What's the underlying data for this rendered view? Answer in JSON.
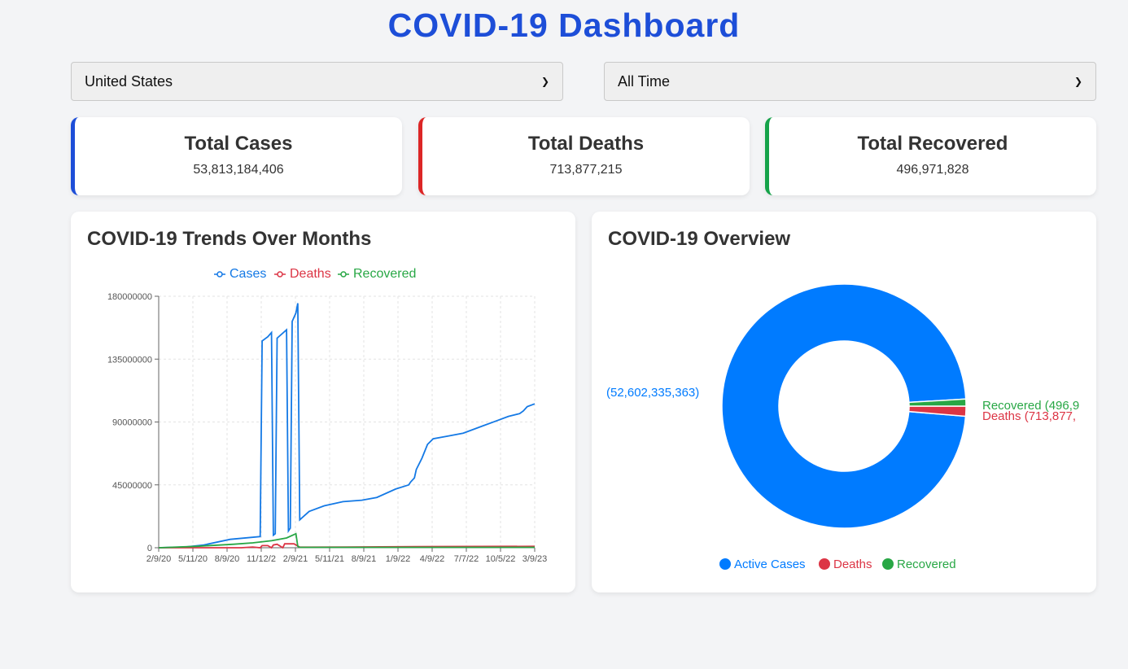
{
  "header": {
    "title": "COVID-19 Dashboard"
  },
  "filters": {
    "country": {
      "value": "United States"
    },
    "period": {
      "value": "All Time"
    }
  },
  "stats": [
    {
      "label": "Total Cases",
      "value": "53,813,184,406",
      "color": "#1d4ed8"
    },
    {
      "label": "Total Deaths",
      "value": "713,877,215",
      "color": "#dc2626"
    },
    {
      "label": "Total Recovered",
      "value": "496,971,828",
      "color": "#16a34a"
    }
  ],
  "colors": {
    "cases": "#1479e5",
    "deaths": "#dc3545",
    "recovered": "#28a745",
    "active": "#007bff"
  },
  "line_panel": {
    "title": "COVID-19 Trends Over Months"
  },
  "pie_panel": {
    "title": "COVID-19 Overview"
  },
  "chart_data": [
    {
      "type": "line",
      "title": "COVID-19 Trends Over Months",
      "x_ticks": [
        "2/9/20",
        "5/11/20",
        "8/9/20",
        "11/12/2",
        "2/9/21",
        "5/11/21",
        "8/9/21",
        "1/9/22",
        "4/9/22",
        "7/7/22",
        "10/5/22",
        "3/9/23"
      ],
      "y_ticks": [
        "180000000",
        "135000000",
        "90000000",
        "45000000",
        "0"
      ],
      "ylim": [
        0,
        180000000
      ],
      "grid": true,
      "legend": "top",
      "series": [
        {
          "name": "Cases",
          "color": "#1479e5",
          "points": [
            [
              0.0,
              0
            ],
            [
              0.07,
              500000
            ],
            [
              0.12,
              2000000
            ],
            [
              0.19,
              6000000
            ],
            [
              0.27,
              8000000
            ],
            [
              0.275,
              148000000
            ],
            [
              0.29,
              151000000
            ],
            [
              0.3,
              154000000
            ],
            [
              0.305,
              9000000
            ],
            [
              0.31,
              10000000
            ],
            [
              0.315,
              150000000
            ],
            [
              0.34,
              156000000
            ],
            [
              0.345,
              12000000
            ],
            [
              0.35,
              14000000
            ],
            [
              0.355,
              162000000
            ],
            [
              0.365,
              168000000
            ],
            [
              0.37,
              175000000
            ],
            [
              0.375,
              20000000
            ],
            [
              0.4,
              26000000
            ],
            [
              0.44,
              30000000
            ],
            [
              0.49,
              33000000
            ],
            [
              0.54,
              34000000
            ],
            [
              0.58,
              36000000
            ],
            [
              0.63,
              42000000
            ],
            [
              0.665,
              45000000
            ],
            [
              0.67,
              47000000
            ],
            [
              0.68,
              50000000
            ],
            [
              0.685,
              56000000
            ],
            [
              0.7,
              64000000
            ],
            [
              0.715,
              74000000
            ],
            [
              0.73,
              78000000
            ],
            [
              0.77,
              80000000
            ],
            [
              0.81,
              82000000
            ],
            [
              0.86,
              87000000
            ],
            [
              0.9,
              91000000
            ],
            [
              0.93,
              94000000
            ],
            [
              0.96,
              96000000
            ],
            [
              0.97,
              98000000
            ],
            [
              0.98,
              101000000
            ],
            [
              1.0,
              103000000
            ]
          ]
        },
        {
          "name": "Deaths",
          "color": "#dc3545",
          "points": [
            [
              0.0,
              0
            ],
            [
              0.22,
              0
            ],
            [
              0.25,
              500000
            ],
            [
              0.27,
              0
            ],
            [
              0.275,
              1500000
            ],
            [
              0.29,
              1500000
            ],
            [
              0.3,
              0
            ],
            [
              0.305,
              2000000
            ],
            [
              0.315,
              2500000
            ],
            [
              0.33,
              0
            ],
            [
              0.335,
              2800000
            ],
            [
              0.36,
              2800000
            ],
            [
              0.375,
              400000
            ],
            [
              0.5,
              500000
            ],
            [
              0.75,
              900000
            ],
            [
              1.0,
              1000000
            ]
          ]
        },
        {
          "name": "Recovered",
          "color": "#28a745",
          "points": [
            [
              0.0,
              0
            ],
            [
              0.1,
              1000000
            ],
            [
              0.2,
              2500000
            ],
            [
              0.25,
              3500000
            ],
            [
              0.3,
              5000000
            ],
            [
              0.34,
              7000000
            ],
            [
              0.365,
              10000000
            ],
            [
              0.37,
              1000000
            ],
            [
              0.375,
              300000
            ],
            [
              0.4,
              300000
            ],
            [
              1.0,
              300000
            ]
          ]
        }
      ]
    },
    {
      "type": "pie",
      "title": "COVID-19 Overview",
      "legend": "bottom",
      "slices": [
        {
          "name": "Active Cases",
          "value": 52602335363,
          "label": "(52,602,335,363)",
          "color": "#007bff"
        },
        {
          "name": "Deaths",
          "value": 713877215,
          "label": "Deaths (713,877,",
          "color": "#dc3545"
        },
        {
          "name": "Recovered",
          "value": 496971828,
          "label": "Recovered (496,9",
          "color": "#28a745"
        }
      ]
    }
  ]
}
